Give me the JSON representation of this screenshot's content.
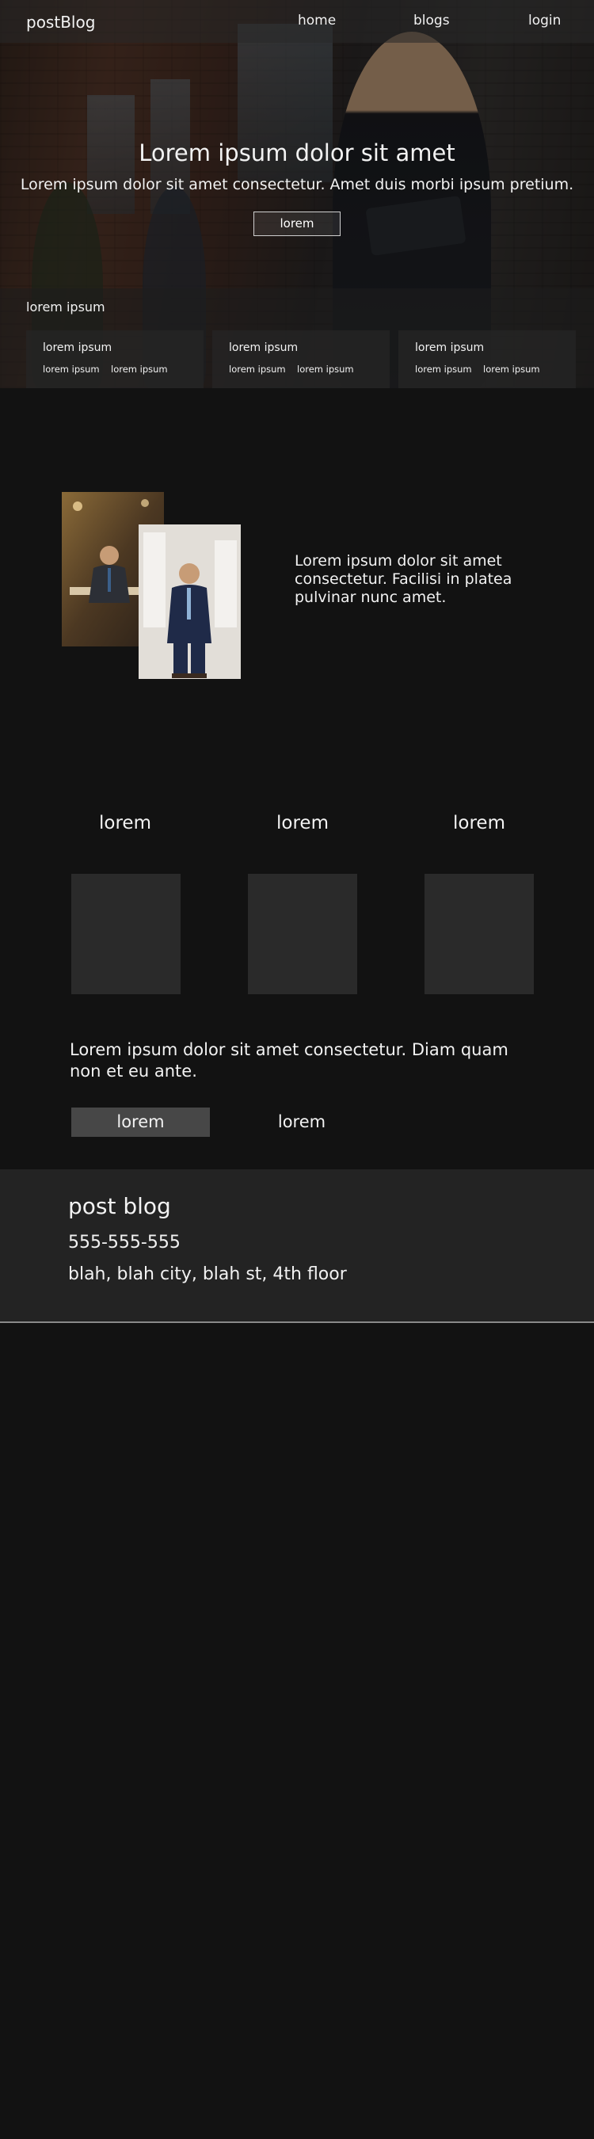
{
  "header": {
    "brand": "postBlog",
    "nav": {
      "home": "home",
      "blogs": "blogs",
      "login": "login"
    }
  },
  "hero": {
    "title": "Lorem ipsum dolor sit amet",
    "subtitle": "Lorem ipsum dolor sit amet consectetur. Amet duis morbi ipsum pretium.",
    "button": "lorem"
  },
  "strip": {
    "title": "lorem ipsum",
    "cards": [
      {
        "title": "lorem ipsum",
        "link1": "lorem ipsum",
        "link2": "lorem ipsum"
      },
      {
        "title": "lorem ipsum",
        "link1": "lorem ipsum",
        "link2": "lorem ipsum"
      },
      {
        "title": "lorem ipsum",
        "link1": "lorem ipsum",
        "link2": "lorem ipsum"
      }
    ]
  },
  "feature": {
    "text": "Lorem ipsum dolor sit amet consectetur. Facilisi in platea pulvinar nunc amet."
  },
  "columns": [
    {
      "heading": "lorem"
    },
    {
      "heading": "lorem"
    },
    {
      "heading": "lorem"
    }
  ],
  "promo": {
    "text": "Lorem ipsum dolor sit amet consectetur. Diam quam non et eu ante.",
    "primary_button": "lorem",
    "secondary_button": "lorem"
  },
  "footer": {
    "title": "post blog",
    "phone": "555-555-555",
    "address": "blah, blah city, blah st, 4th floor"
  }
}
